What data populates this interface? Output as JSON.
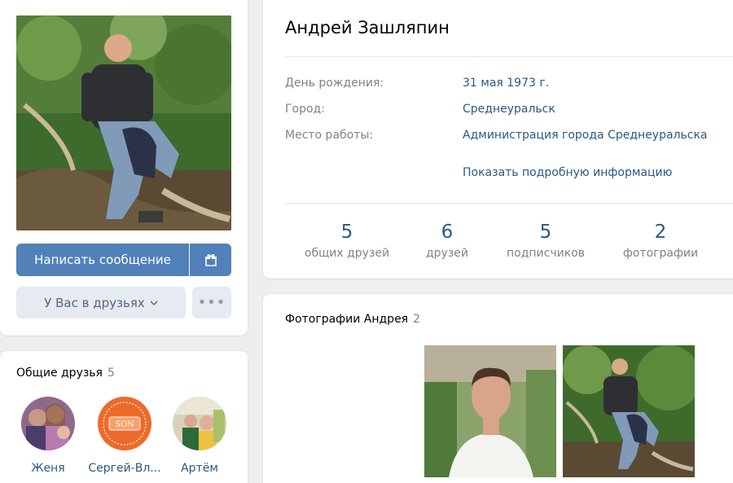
{
  "profile": {
    "name": "Андрей Зашляпин",
    "info": [
      {
        "label": "День рождения:",
        "value": "31 мая 1973 г."
      },
      {
        "label": "Город:",
        "value": "Среднеуральск"
      },
      {
        "label": "Место работы:",
        "value": "Администрация города Среднеуральска"
      }
    ],
    "show_more": "Показать подробную информацию",
    "counters": [
      {
        "num": "5",
        "label": "общих друзей"
      },
      {
        "num": "6",
        "label": "друзей"
      },
      {
        "num": "5",
        "label": "подписчиков"
      },
      {
        "num": "2",
        "label": "фотографии"
      }
    ]
  },
  "actions": {
    "write_message": "Написать сообщение",
    "gift_icon": "gift-icon",
    "in_friends": "У Вас в друзьях",
    "more": "•••"
  },
  "common_friends": {
    "title": "Общие друзья",
    "count": "5",
    "items": [
      {
        "name": "Женя"
      },
      {
        "name": "Сергей-Вл..."
      },
      {
        "name": "Артём"
      }
    ]
  },
  "photos": {
    "title": "Фотографии Андрея",
    "count": "2"
  },
  "colors": {
    "accent": "#5181b8",
    "link": "#2a5885",
    "muted": "#828282",
    "background": "#edeef0"
  }
}
